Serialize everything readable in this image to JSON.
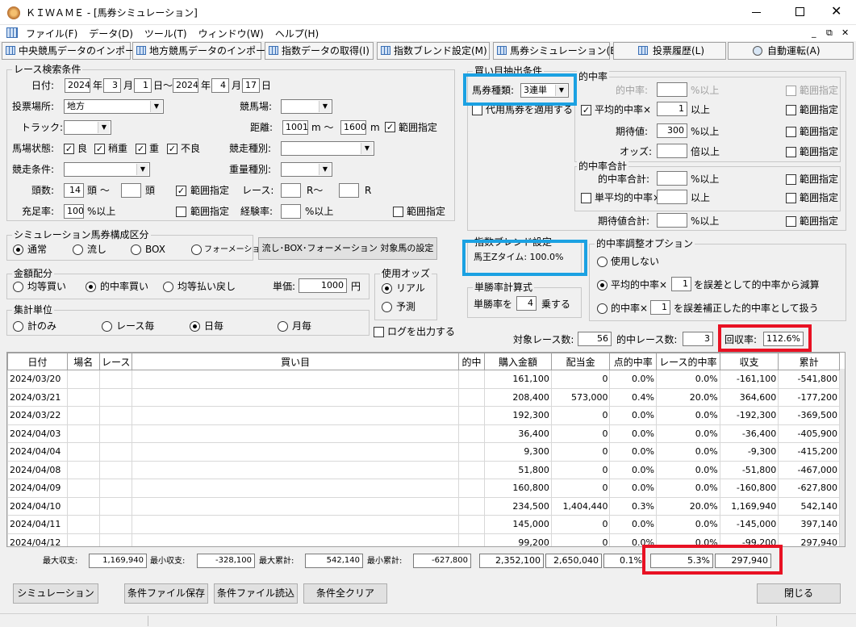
{
  "window": {
    "title": "ＫＩＷＡＭＥ - [馬券シミュレーション]"
  },
  "menu": [
    "ファイル(F)",
    "データ(D)",
    "ツール(T)",
    "ウィンドウ(W)",
    "ヘルプ(H)"
  ],
  "toolbar": [
    "中央競馬データのインポート(J)",
    "地方競馬データのインポート(N)",
    "指数データの取得(I)",
    "指数ブレンド設定(M)",
    "馬券シミュレーション(B)",
    "投票履歴(L)",
    "自動運転(A)"
  ],
  "search": {
    "title": "レース検索条件",
    "date_label": "日付:",
    "from_year": "2024",
    "year": "年",
    "from_month": "3",
    "month": "月",
    "from_day": "1",
    "day_tilde": "日～",
    "to_year": "2024",
    "to_month": "4",
    "to_day": "17",
    "day": "日",
    "venue_label": "投票場所:",
    "venue": "地方",
    "track_label": "競馬場:",
    "track_type_label": "トラック:",
    "distance_label": "距離:",
    "distance_from": "1001",
    "m_tilde": "m ～",
    "distance_to": "1600",
    "m": "m",
    "range": "範囲指定",
    "condition_label": "馬場状態:",
    "cond_good": "良",
    "cond_slight": "稍重",
    "cond_heavy": "重",
    "cond_bad": "不良",
    "race_type_label": "競走種別:",
    "race_cond_label": "競走条件:",
    "weight_label": "重量種別:",
    "heads_label": "頭数:",
    "heads_from": "14",
    "heads_tilde": "頭 ～",
    "heads": "頭",
    "race_label": "レース:",
    "r_tilde": "R～",
    "r": "R",
    "fill_label": "充足率:",
    "fill_value": "100",
    "pct_above": "%以上",
    "exp_label": "経験率:"
  },
  "structure": {
    "title": "シミュレーション馬券構成区分",
    "normal": "通常",
    "nagashi": "流し",
    "box": "BOX",
    "formation": "フォーメーション",
    "set_button": "流し･BOX･フォーメーション 対象馬の設定"
  },
  "amount": {
    "title": "金額配分",
    "equal_buy": "均等買い",
    "hit_rate_buy": "的中率買い",
    "equal_payout": "均等払い戻し",
    "unit_label": "単価:",
    "unit_value": "1000",
    "yen": "円"
  },
  "odds": {
    "title": "使用オッズ",
    "real": "リアル",
    "forecast": "予測"
  },
  "agg": {
    "title": "集計単位",
    "total": "計のみ",
    "per_race": "レース毎",
    "per_day": "日毎",
    "per_month": "月毎"
  },
  "log_label": "ログを出力する",
  "buy": {
    "title": "買い目抽出条件",
    "ticket_label": "馬券種類:",
    "ticket_value": "3連単",
    "alt_label": "代用馬券を適用する",
    "hit_title": "的中率",
    "hit_rate_label": "的中率:",
    "avg_hit_label": "平均的中率×",
    "avg_hit_value": "1",
    "above": "以上",
    "expected_label": "期待値:",
    "expected_value": "300",
    "odds_label": "オッズ:",
    "times_above": "倍以上",
    "total_title": "的中率合計",
    "total_label": "的中率合計:",
    "single_avg_label": "単平均的中率×",
    "exp_total_label": "期待値合計:"
  },
  "blend": {
    "title": "指数ブレンド設定",
    "text": "馬王Zタイム: 100.0%"
  },
  "win_calc": {
    "title": "単勝率計算式",
    "text1": "単勝率を",
    "value": "4",
    "text2": "乗する"
  },
  "adjust": {
    "title": "的中率調整オプション",
    "opt_none": "使用しない",
    "opt_avg_pre": "平均的中率×",
    "opt_avg_val": "1",
    "opt_avg_post": "を誤差として的中率から減算",
    "opt_rate_pre": "的中率×",
    "opt_rate_val": "1",
    "opt_rate_post": "を誤差補正した的中率として扱う"
  },
  "summary": {
    "races_label": "対象レース数:",
    "races": "56",
    "hit_label": "的中レース数:",
    "hit": "3",
    "recovery_label": "回収率:",
    "recovery": "112.6%"
  },
  "table": {
    "headers": [
      "日付",
      "場名",
      "レース",
      "買い目",
      "的中",
      "購入金額",
      "配当金",
      "点的中率",
      "レース的中率",
      "収支",
      "累計"
    ],
    "rows": [
      [
        "2024/03/20",
        "",
        "",
        "",
        "",
        "161,100",
        "0",
        "0.0%",
        "0.0%",
        "-161,100",
        "-541,800"
      ],
      [
        "2024/03/21",
        "",
        "",
        "",
        "",
        "208,400",
        "573,000",
        "0.4%",
        "20.0%",
        "364,600",
        "-177,200"
      ],
      [
        "2024/03/22",
        "",
        "",
        "",
        "",
        "192,300",
        "0",
        "0.0%",
        "0.0%",
        "-192,300",
        "-369,500"
      ],
      [
        "2024/04/03",
        "",
        "",
        "",
        "",
        "36,400",
        "0",
        "0.0%",
        "0.0%",
        "-36,400",
        "-405,900"
      ],
      [
        "2024/04/04",
        "",
        "",
        "",
        "",
        "9,300",
        "0",
        "0.0%",
        "0.0%",
        "-9,300",
        "-415,200"
      ],
      [
        "2024/04/08",
        "",
        "",
        "",
        "",
        "51,800",
        "0",
        "0.0%",
        "0.0%",
        "-51,800",
        "-467,000"
      ],
      [
        "2024/04/09",
        "",
        "",
        "",
        "",
        "160,800",
        "0",
        "0.0%",
        "0.0%",
        "-160,800",
        "-627,800"
      ],
      [
        "2024/04/10",
        "",
        "",
        "",
        "",
        "234,500",
        "1,404,440",
        "0.3%",
        "20.0%",
        "1,169,940",
        "542,140"
      ],
      [
        "2024/04/11",
        "",
        "",
        "",
        "",
        "145,000",
        "0",
        "0.0%",
        "0.0%",
        "-145,000",
        "397,140"
      ],
      [
        "2024/04/12",
        "",
        "",
        "",
        "",
        "99,200",
        "0",
        "0.0%",
        "0.0%",
        "-99,200",
        "297,940"
      ]
    ]
  },
  "footer": {
    "max_income_label": "最大収支:",
    "max_income": "1,169,940",
    "min_income_label": "最小収支:",
    "min_income": "-328,100",
    "max_cum_label": "最大累計:",
    "max_cum": "542,140",
    "min_cum_label": "最小累計:",
    "min_cum": "-627,800",
    "total_buy": "2,352,100",
    "total_payout": "2,650,040",
    "point_hit": "0.1%",
    "race_hit": "5.3%",
    "total_income": "297,940"
  },
  "buttons": {
    "simulation": "シミュレーション",
    "save": "条件ファイル保存",
    "load": "条件ファイル読込",
    "clear": "条件全クリア",
    "close": "閉じる"
  }
}
